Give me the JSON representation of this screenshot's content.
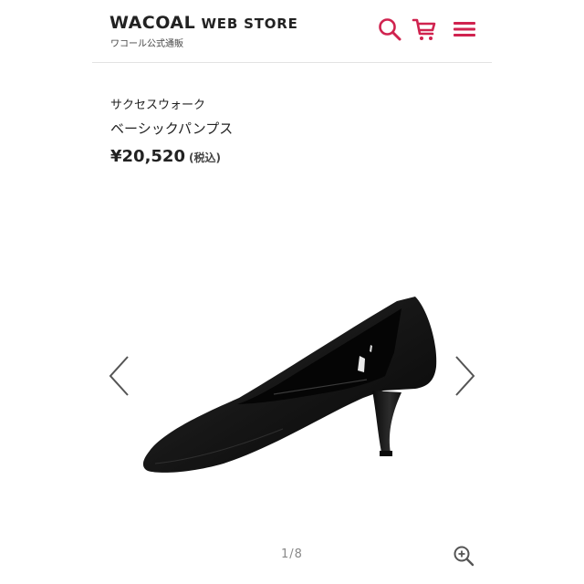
{
  "header": {
    "brand_main": "WACOAL",
    "brand_rest": "WEB STORE",
    "brand_sub": "ワコール公式通販",
    "icons": [
      "search-icon",
      "cart-icon",
      "menu-icon"
    ],
    "accent_color": "#d0234f"
  },
  "product": {
    "brand_name": "サクセスウォーク",
    "name": "ベーシックパンプス",
    "price": "¥20,520",
    "tax_label": "(税込)"
  },
  "gallery": {
    "counter": "1/8",
    "prev_icon": "chevron-left-icon",
    "next_icon": "chevron-right-icon",
    "zoom_icon": "zoom-in-icon"
  }
}
